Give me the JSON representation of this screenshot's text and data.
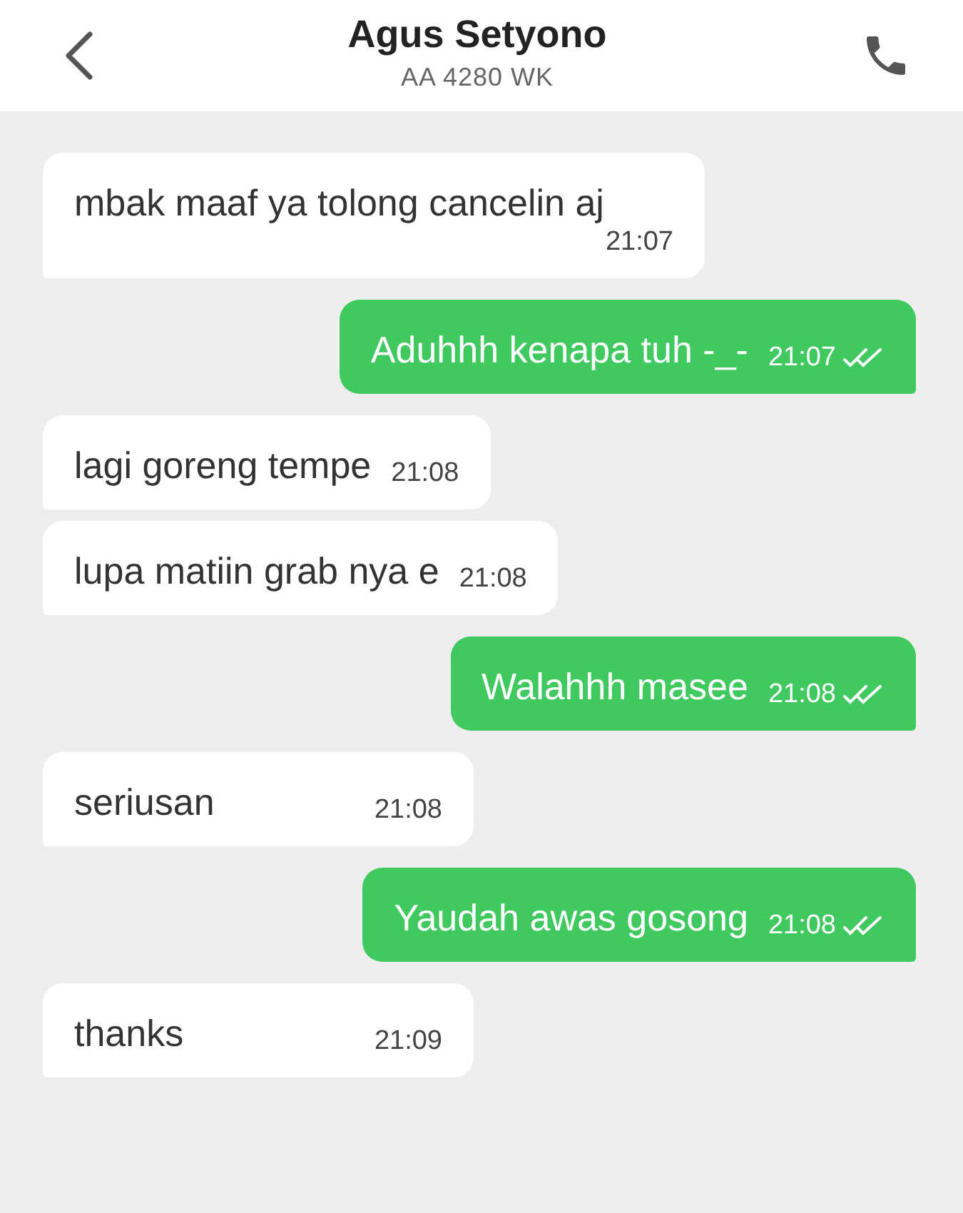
{
  "header": {
    "title": "Agus Setyono",
    "subtitle": "AA 4280 WK"
  },
  "messages": [
    {
      "kind": "incoming",
      "text": "mbak maaf ya tolong cancelin aj",
      "time": "21:07"
    },
    {
      "kind": "outgoing",
      "text": "Aduhhh kenapa tuh -_-",
      "time": "21:07",
      "read": true
    },
    {
      "kind": "incoming",
      "text": "lagi goreng tempe",
      "time": "21:08"
    },
    {
      "kind": "incoming",
      "text": "lupa matiin grab nya e",
      "time": "21:08"
    },
    {
      "kind": "outgoing",
      "text": "Walahhh masee",
      "time": "21:08",
      "read": true
    },
    {
      "kind": "incoming",
      "text": "seriusan",
      "time": "21:08"
    },
    {
      "kind": "outgoing",
      "text": "Yaudah awas gosong",
      "time": "21:08",
      "read": true
    },
    {
      "kind": "incoming",
      "text": "thanks",
      "time": "21:09"
    }
  ]
}
